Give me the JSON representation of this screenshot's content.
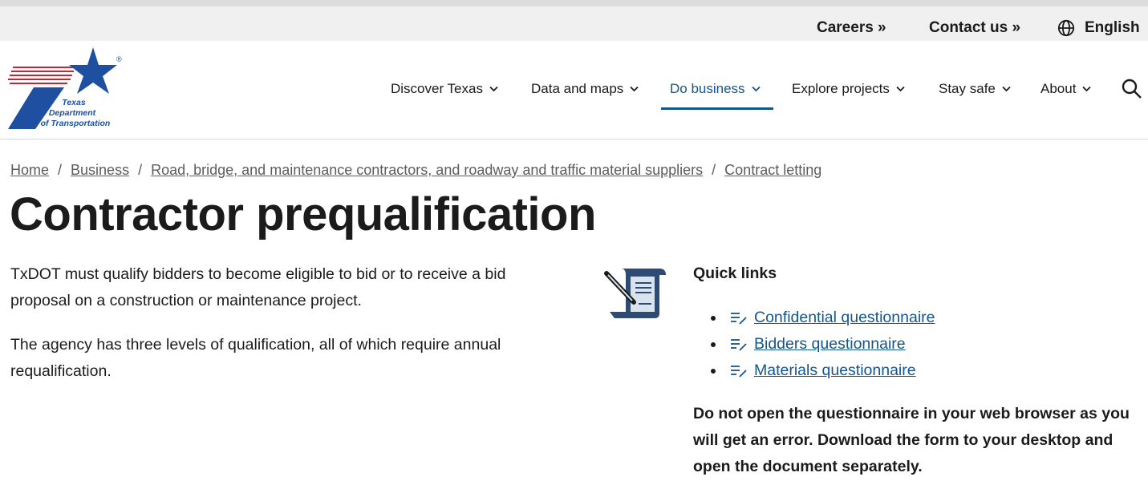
{
  "utility_nav": {
    "careers": "Careers »",
    "contact": "Contact us »",
    "language": "English",
    "language_icon": "globe-icon"
  },
  "logo": {
    "line1": "Texas",
    "line2": "Department",
    "line3": "of Transportation",
    "mark": "®",
    "colors": {
      "blue": "#1f4fa0",
      "red": "#d2202f"
    }
  },
  "main_nav": {
    "items": [
      {
        "label": "Discover Texas",
        "icon": "chevron-down-icon"
      },
      {
        "label": "Data and maps",
        "icon": "chevron-down-icon"
      },
      {
        "label": "Do business",
        "icon": "chevron-down-icon",
        "active": true
      },
      {
        "label": "Explore projects",
        "icon": "chevron-down-icon"
      },
      {
        "label": "Stay safe",
        "icon": "chevron-down-icon"
      },
      {
        "label": "About",
        "icon": "chevron-down-icon"
      }
    ],
    "search_icon": "search-icon",
    "accent_color": "#14558f"
  },
  "breadcrumb": {
    "items": [
      "Home",
      "Business",
      "Road, bridge, and maintenance contractors, and roadway and traffic material suppliers",
      "Contract letting"
    ],
    "separator": "/"
  },
  "page": {
    "title": "Contractor prequalification",
    "intro": [
      "TxDOT must qualify bidders to become eligible to bid or to receive a bid proposal on a construction or maintenance project.",
      "The agency has three levels of qualification, all of which require annual requalification."
    ]
  },
  "quick_links": {
    "icon": "document-scroll-icon",
    "title": "Quick links",
    "item_icon": "form-edit-icon",
    "items": [
      "Confidential questionnaire",
      "Bidders questionnaire",
      "Materials questionnaire"
    ],
    "notice": "Do not open the questionnaire in your web browser as you will get an error. Download the form to your desktop and open the document separately."
  }
}
